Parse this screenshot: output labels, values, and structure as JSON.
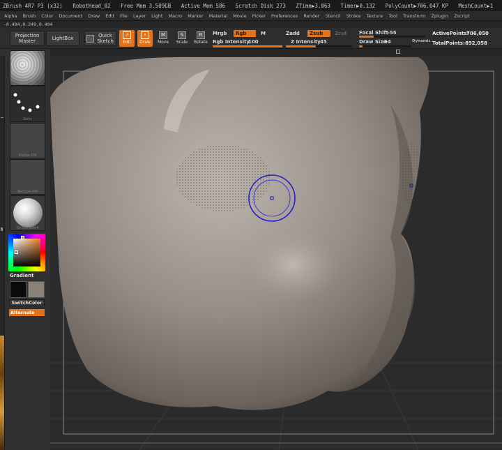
{
  "titlebar": {
    "app": "ZBrush 4R7 P3 (x32)",
    "doc": "RobotHead_02",
    "free_mem": "Free Mem 3.509GB",
    "active_mem": "Active Mem 586",
    "scratch": "Scratch Disk 273",
    "ztime": "ZTime▶3.063",
    "timer": "Timer▶0.132",
    "polycount": "PolyCount▶706.047 KP",
    "meshcount": "MeshCount▶1"
  },
  "menus": [
    "Alpha",
    "Brush",
    "Color",
    "Document",
    "Draw",
    "Edit",
    "File",
    "Layer",
    "Light",
    "Macro",
    "Marker",
    "Material",
    "Movie",
    "Picker",
    "Preferences",
    "Render",
    "Stencil",
    "Stroke",
    "Texture",
    "Tool",
    "Transform",
    "Zplugin",
    "Zscript"
  ],
  "coords": "-0.494,0.249,0.494",
  "toolbar": {
    "projection_master": "Projection Master",
    "lightbox": "LightBox",
    "quick_sketch": "Quick Sketch",
    "edit": "Edit",
    "draw": "Draw",
    "move": "Move",
    "scale": "Scale",
    "rotate": "Rotate",
    "mrgb": "Mrgb",
    "rgb": "Rgb",
    "m": "M",
    "zadd": "Zadd",
    "zsub": "Zsub",
    "zcut": "Zcut",
    "rgb_intensity_label": "Rgb  Intensity",
    "rgb_intensity": "100",
    "z_intensity_label": "Z Intensity",
    "z_intensity": "45",
    "focal_shift_label": "Focal Shift",
    "focal_shift": "-55",
    "draw_size_label": "Draw Size",
    "draw_size": "64",
    "dynamic": "Dynamic",
    "active_points_label": "ActivePoints:",
    "active_points": "706,050",
    "total_points_label": "TotalPoints:",
    "total_points": "892,058"
  },
  "slider_levels": {
    "rgb_intensity_pct": 100,
    "z_intensity_pct": 45,
    "focal_shift_value": -55,
    "draw_size_value": 64
  },
  "left": {
    "brush": "Smooth",
    "stroke": "Dots",
    "alpha": "Alpha Off",
    "texture": "Texture Off",
    "material": "SkinShade4",
    "gradient": "Gradient",
    "switch_color": "SwitchColor",
    "alternate": "Alternate"
  },
  "colors": {
    "accent": "#e0731c",
    "primary_color": "#0a0a0a",
    "secondary_color": "#8a8178",
    "mesh": "#8f8881",
    "cursor": "#2020c8"
  }
}
